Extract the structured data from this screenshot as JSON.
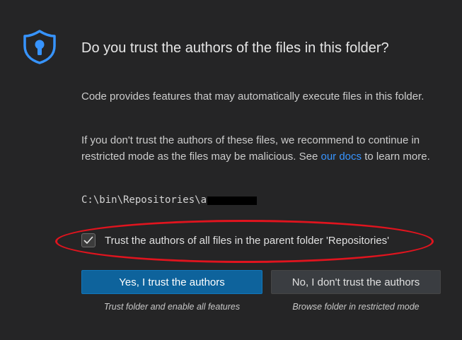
{
  "dialog": {
    "title": "Do you trust the authors of the files in this folder?",
    "paragraph1": "Code provides features that may automatically execute files in this folder.",
    "paragraph2_before": "If you don't trust the authors of these files, we recommend to continue in restricted mode as the files may be malicious. See ",
    "paragraph2_link": "our docs",
    "paragraph2_after": " to learn more.",
    "folder_path": "C:\\bin\\Repositories\\a",
    "checkbox": {
      "label": "Trust the authors of all files in the parent folder 'Repositories'",
      "checked": true
    },
    "buttons": {
      "trust_label": "Yes, I trust the authors",
      "trust_subtitle": "Trust folder and enable all features",
      "distrust_label": "No, I don't trust the authors",
      "distrust_subtitle": "Browse folder in restricted mode"
    },
    "icons": {
      "shield": "shield-lock-icon",
      "check": "checkmark-icon"
    },
    "colors": {
      "background": "#252526",
      "accent": "#0e639c",
      "link": "#3794ff",
      "shield": "#3794ff",
      "annotation": "#e0141e"
    }
  }
}
